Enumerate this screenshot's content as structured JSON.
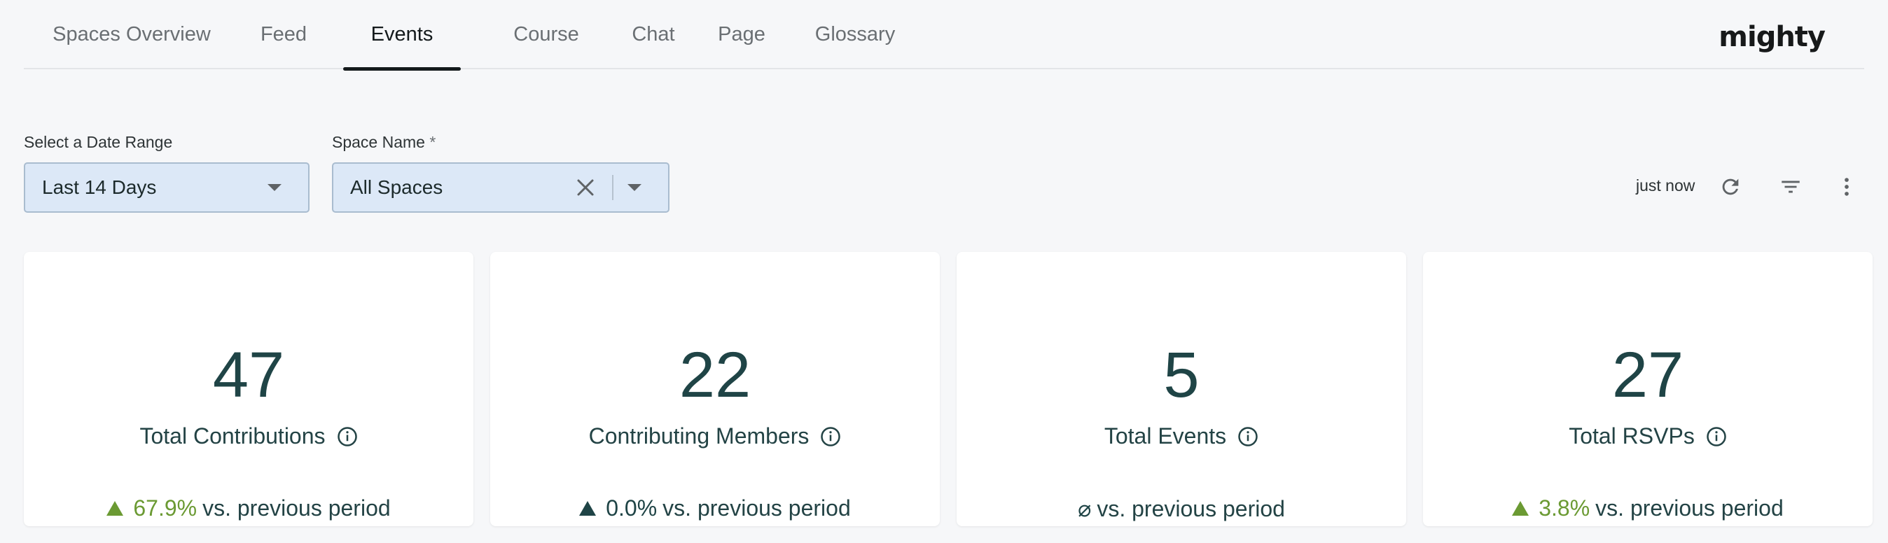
{
  "tabs": [
    {
      "label": "Spaces Overview",
      "active": false
    },
    {
      "label": "Feed",
      "active": false
    },
    {
      "label": "Events",
      "active": true
    },
    {
      "label": "Course",
      "active": false
    },
    {
      "label": "Chat",
      "active": false
    },
    {
      "label": "Page",
      "active": false
    },
    {
      "label": "Glossary",
      "active": false
    }
  ],
  "brand": {
    "logo_text": "mighty"
  },
  "filters": {
    "date_range": {
      "label": "Select a Date Range",
      "value": "Last 14 Days"
    },
    "space_name": {
      "label": "Space Name",
      "required_mark": "*",
      "value": "All Spaces"
    }
  },
  "toolbar": {
    "updated_text": "just now",
    "icons": [
      "refresh-icon",
      "filter-icon",
      "more-vertical-icon"
    ]
  },
  "colors": {
    "accent_positive": "#6b9a33",
    "metric_text": "#1f4446",
    "select_bg": "#dce8f7"
  },
  "cards": [
    {
      "value": "47",
      "label": "Total Contributions",
      "delta": "67.9%",
      "compare_text": "vs. previous period",
      "trend": "up-positive"
    },
    {
      "value": "22",
      "label": "Contributing Members",
      "delta": "0.0%",
      "compare_text": "vs. previous period",
      "trend": "up-neutral"
    },
    {
      "value": "5",
      "label": "Total Events",
      "delta": "⌀",
      "compare_text": "vs. previous period",
      "trend": "none"
    },
    {
      "value": "27",
      "label": "Total RSVPs",
      "delta": "3.8%",
      "compare_text": "vs. previous period",
      "trend": "up-positive"
    }
  ]
}
